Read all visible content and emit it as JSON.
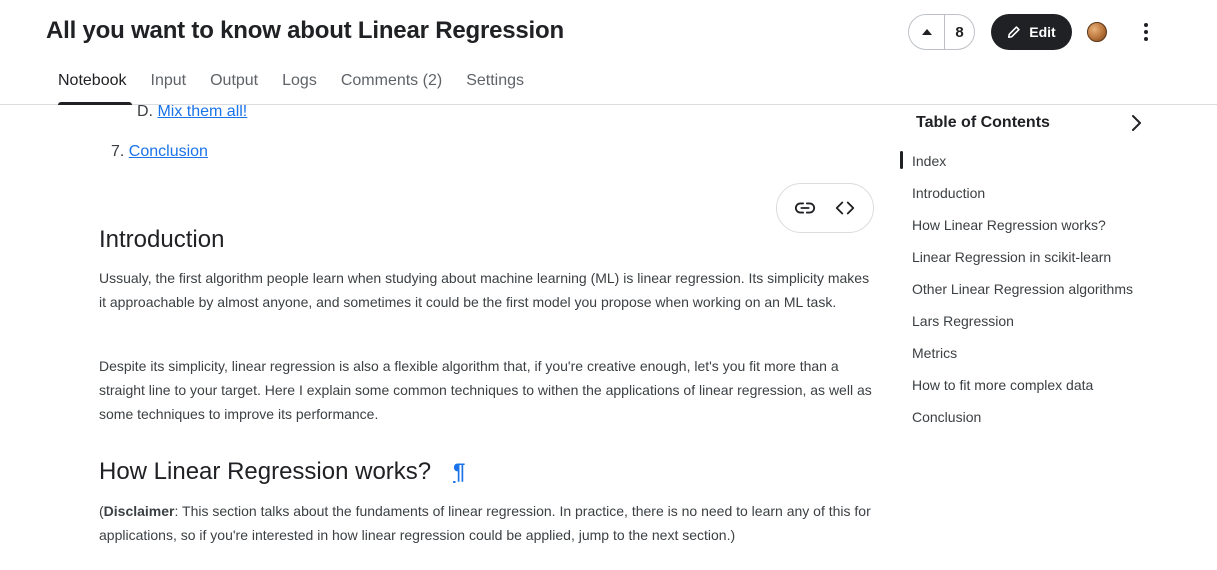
{
  "header": {
    "title": "All you want to know about Linear Regression",
    "vote_count": "8",
    "edit_label": "Edit"
  },
  "tabs": [
    {
      "label": "Notebook"
    },
    {
      "label": "Input"
    },
    {
      "label": "Output"
    },
    {
      "label": "Logs"
    },
    {
      "label": "Comments (2)"
    },
    {
      "label": "Settings"
    }
  ],
  "content": {
    "toc": {
      "d_marker": "D.",
      "d_label": "Mix them all!",
      "seven_marker": "7.",
      "seven_label": "Conclusion"
    },
    "intro": {
      "heading": "Introduction",
      "p1": "Ussualy, the first algorithm people learn when studying about machine learning (ML) is linear regression. Its simplicity makes it approachable by almost anyone, and sometimes it could be the first model you propose when working on an ML task.",
      "p2": "Despite its simplicity, linear regression is also a flexible algorithm that, if you're creative enough, let's you fit more than a straight line to your target. Here I explain some common techniques to withen the applications of linear regression, as well as some techniques to improve its performance."
    },
    "how": {
      "heading": "How Linear Regression works?",
      "anchor": "¶",
      "disclaimer_open": "(",
      "disclaimer_bold": "Disclaimer",
      "disclaimer_text": ": This section talks about the fundaments of linear regression. In practice, there is no need to learn any of this for applications, so if you're interested in how linear regression could be applied, jump to the next section.)"
    }
  },
  "sidebar": {
    "title": "Table of Contents",
    "items": [
      {
        "label": "Index"
      },
      {
        "label": "Introduction"
      },
      {
        "label": "How Linear Regression works?"
      },
      {
        "label": "Linear Regression in scikit-learn"
      },
      {
        "label": "Other Linear Regression algorithms"
      },
      {
        "label": "Lars Regression"
      },
      {
        "label": "Metrics"
      },
      {
        "label": "How to fit more complex data"
      },
      {
        "label": "Conclusion"
      }
    ]
  },
  "colors": {
    "accent": "#202124",
    "link": "#1a73e8"
  }
}
